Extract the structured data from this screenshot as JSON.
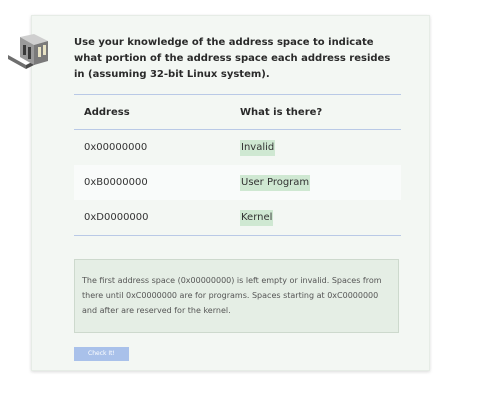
{
  "question": {
    "prompt": "Use your knowledge of the address space to indicate what portion of the address space each address resides in (assuming 32-bit Linux system)."
  },
  "table": {
    "headers": [
      "Address",
      "What is there?"
    ],
    "rows": [
      {
        "address": "0x00000000",
        "answer": "Invalid"
      },
      {
        "address": "0xB0000000",
        "answer": "User Program"
      },
      {
        "address": "0xD0000000",
        "answer": "Kernel"
      }
    ]
  },
  "feedback": {
    "text": "The first address space (0x00000000) is left empty or invalid. Spaces from there until 0xC0000000 are for programs. Spaces starting at 0xC0000000 and after are reserved for the kernel."
  },
  "actions": {
    "check_label": "Check It!"
  },
  "colors": {
    "card_bg": "#f3f7f3",
    "answer_highlight": "#cfe8d2",
    "button": "#a9c1ea",
    "table_rule": "#b9c9e6"
  },
  "icons": {
    "logo": "cube-logo-icon"
  }
}
